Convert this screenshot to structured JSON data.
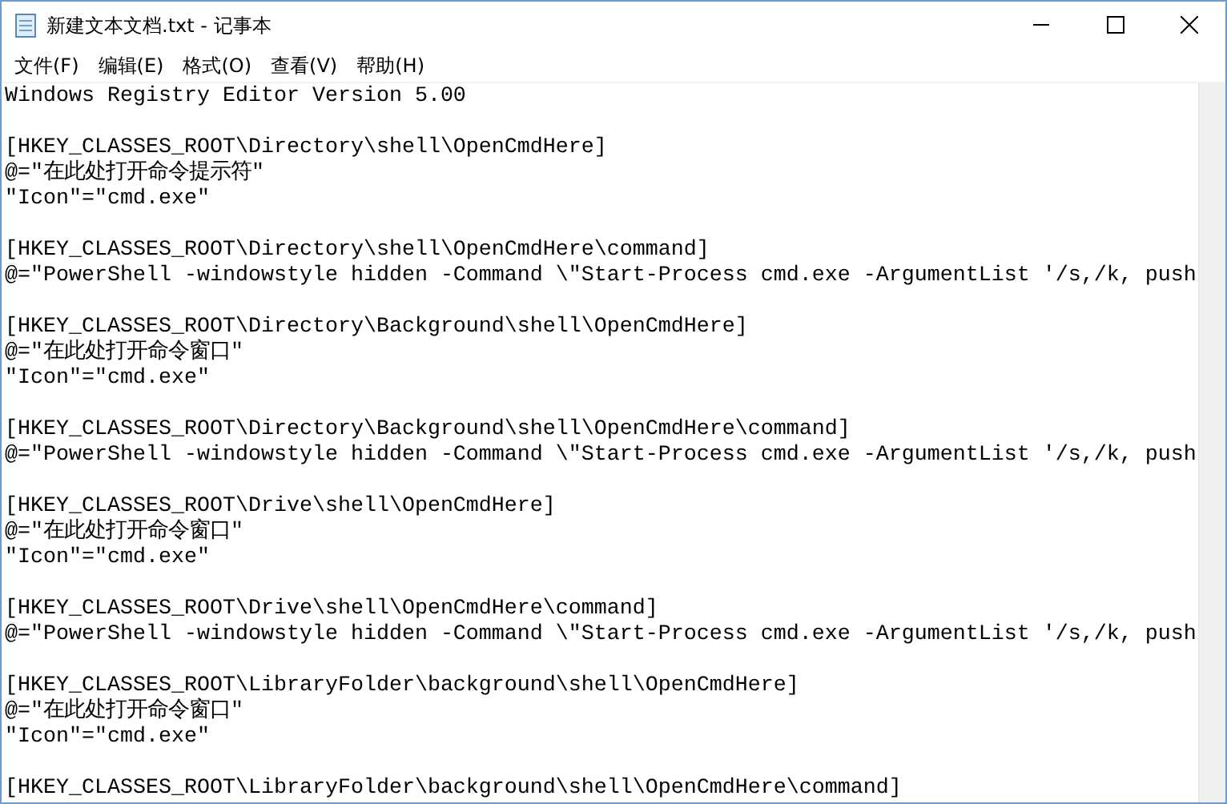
{
  "window": {
    "title": "新建文本文档.txt - 记事本"
  },
  "menu": [
    {
      "label": "文件(F)"
    },
    {
      "label": "编辑(E)"
    },
    {
      "label": "格式(O)"
    },
    {
      "label": "查看(V)"
    },
    {
      "label": "帮助(H)"
    }
  ],
  "document": {
    "blocks": [
      [
        "Windows Registry Editor Version 5.00"
      ],
      [
        "[HKEY_CLASSES_ROOT\\Directory\\shell\\OpenCmdHere]",
        "@=\"在此处打开命令提示符\"",
        "\"Icon\"=\"cmd.exe\""
      ],
      [
        "[HKEY_CLASSES_ROOT\\Directory\\shell\\OpenCmdHere\\command]",
        "@=\"PowerShell -windowstyle hidden -Command \\\"Start-Process cmd.exe -ArgumentList '/s,/k, push"
      ],
      [
        "[HKEY_CLASSES_ROOT\\Directory\\Background\\shell\\OpenCmdHere]",
        "@=\"在此处打开命令窗口\"",
        "\"Icon\"=\"cmd.exe\""
      ],
      [
        "[HKEY_CLASSES_ROOT\\Directory\\Background\\shell\\OpenCmdHere\\command]",
        "@=\"PowerShell -windowstyle hidden -Command \\\"Start-Process cmd.exe -ArgumentList '/s,/k, push"
      ],
      [
        "[HKEY_CLASSES_ROOT\\Drive\\shell\\OpenCmdHere]",
        "@=\"在此处打开命令窗口\"",
        "\"Icon\"=\"cmd.exe\""
      ],
      [
        "[HKEY_CLASSES_ROOT\\Drive\\shell\\OpenCmdHere\\command]",
        "@=\"PowerShell -windowstyle hidden -Command \\\"Start-Process cmd.exe -ArgumentList '/s,/k, push"
      ],
      [
        "[HKEY_CLASSES_ROOT\\LibraryFolder\\background\\shell\\OpenCmdHere]",
        "@=\"在此处打开命令窗口\"",
        "\"Icon\"=\"cmd.exe\""
      ],
      [
        "[HKEY_CLASSES_ROOT\\LibraryFolder\\background\\shell\\OpenCmdHere\\command]"
      ]
    ]
  }
}
